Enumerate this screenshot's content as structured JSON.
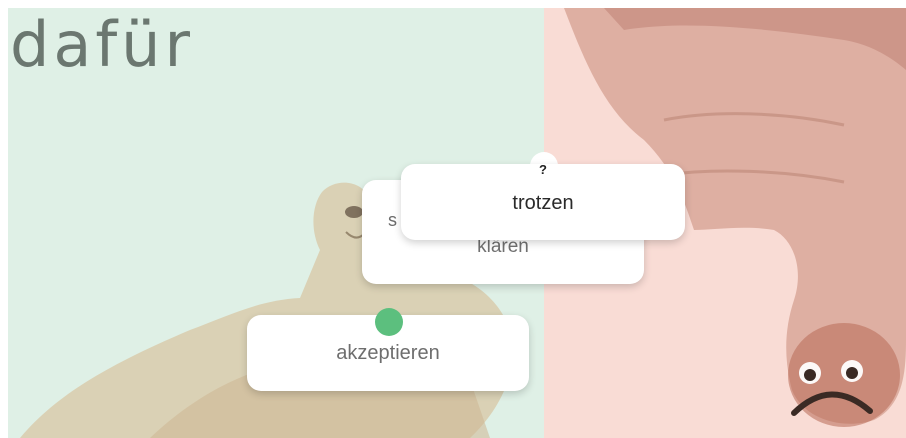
{
  "heading": {
    "word": "dafür"
  },
  "colors": {
    "left_panel": "#dff0e6",
    "right_panel": "#f9dcd5",
    "card_bg": "#ffffff",
    "green_marker": "#5cbf7e",
    "title_text": "#5f6b64"
  },
  "images": {
    "left": "thumbs-up-hand",
    "right": "thumbs-down-hand-with-sad-face"
  },
  "cards": {
    "klaren": {
      "partial_prefix": "s",
      "label": "klären"
    },
    "akzeptieren": {
      "label": "akzeptieren"
    },
    "trotzen": {
      "question_mark": "?",
      "label": "trotzen"
    }
  }
}
